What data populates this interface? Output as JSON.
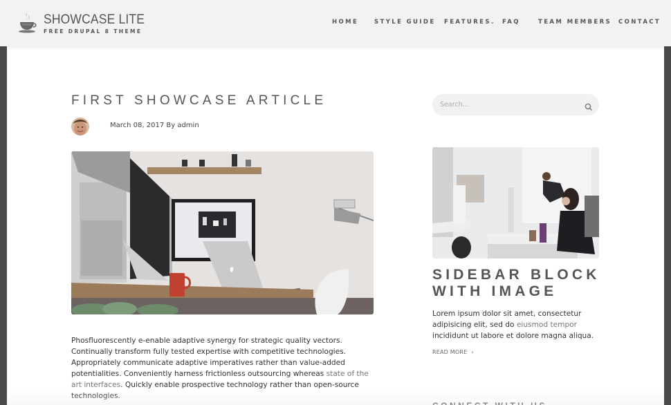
{
  "header": {
    "site_name": "SHOWCASE LITE",
    "site_slogan": "FREE DRUPAL 8 THEME",
    "logo_icon": "coffee-cup-icon"
  },
  "nav": {
    "items": [
      {
        "label": "HOME"
      },
      {
        "label": "STYLE GUIDE"
      },
      {
        "label": "FEATURES",
        "has_dropdown": true,
        "caret": "⌄"
      },
      {
        "label": "FAQ"
      },
      {
        "label": "TEAM MEMBERS"
      },
      {
        "label": "CONTACT"
      }
    ]
  },
  "article": {
    "title": "FIRST SHOWCASE ARTICLE",
    "meta": "March 08, 2017 By admin",
    "image_alt": "Desk workspace with iMac, monitor, laptop and red mug",
    "body": {
      "part1": "Phosfluorescently e-enable adaptive synergy for strategic quality vectors. Continually transform fully tested expertise with competitive technologies. Appropriately communicate adaptive imperatives rather than value-added potentialities. Conveniently harness frictionless outsourcing whereas ",
      "link": "state of the art interfaces",
      "part2": ". Quickly enable prospective technology rather than open-source technologies."
    }
  },
  "sidebar": {
    "search": {
      "placeholder": "Search...",
      "value": ""
    },
    "block": {
      "image_alt": "Office with people working at desks",
      "title": "SIDEBAR BLOCK WITH IMAGE",
      "text_part1": "Lorem ipsum dolor sit amet, consectetur adipisicing elit, sed do ",
      "text_link": "eiusmod tempor",
      "text_part2": " incididunt ut labore et dolore magna aliqua.",
      "read_more": "READ MORE",
      "read_more_chevron": "›"
    },
    "connect_title": "CONNECT WITH US"
  },
  "colors": {
    "page_border": "#4a4a4a",
    "header_bg": "#f2f2f3",
    "text": "#333333",
    "heading": "#555555",
    "link": "#777777",
    "search_bg": "#f1f1f1"
  }
}
